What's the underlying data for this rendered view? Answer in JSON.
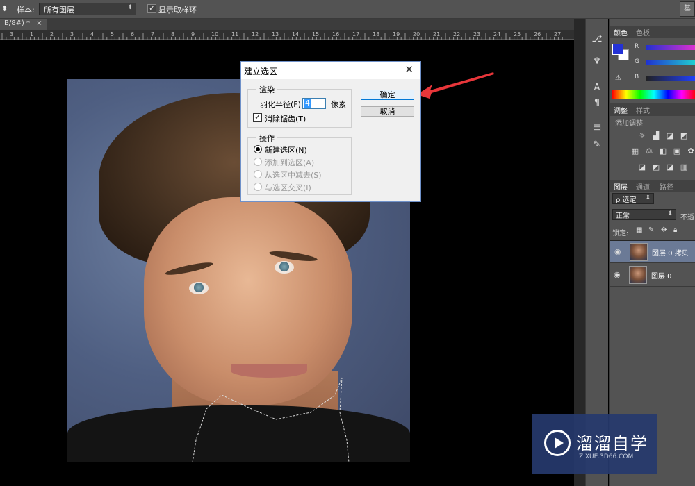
{
  "options_bar": {
    "sample_label": "样本:",
    "sample_value": "所有图层",
    "show_ring_label": "显示取样环",
    "show_ring_checked": true
  },
  "document": {
    "tab_title": "B/8#) *",
    "tab_close": "×",
    "ruler_ticks": [
      "3",
      "1",
      "2",
      "3",
      "4",
      "5",
      "6",
      "7",
      "8",
      "9",
      "10",
      "11",
      "12",
      "13",
      "14",
      "15",
      "16",
      "17",
      "18",
      "19",
      "20",
      "21",
      "22",
      "23",
      "24",
      "25",
      "26",
      "27"
    ]
  },
  "dialog": {
    "title": "建立选区",
    "close": "✕",
    "render_group": "渲染",
    "feather_label": "羽化半径(F):",
    "feather_value": "4",
    "feather_unit": "像素",
    "antialias_label": "消除锯齿(T)",
    "antialias_checked": true,
    "operation_group": "操作",
    "options": [
      {
        "label": "新建选区(N)",
        "selected": true,
        "enabled": true
      },
      {
        "label": "添加到选区(A)",
        "selected": false,
        "enabled": false
      },
      {
        "label": "从选区中减去(S)",
        "selected": false,
        "enabled": false
      },
      {
        "label": "与选区交叉(I)",
        "selected": false,
        "enabled": false
      }
    ],
    "ok": "确定",
    "cancel": "取消"
  },
  "panels": {
    "color_tabs": [
      "颜色",
      "色板"
    ],
    "channels": [
      "R",
      "G",
      "B"
    ],
    "adjust_tabs": [
      "调整",
      "样式"
    ],
    "add_adjustment": "添加调整",
    "layer_tabs": [
      "图层",
      "通道",
      "路径"
    ],
    "filter": "ρ 选定",
    "blend_mode": "正常",
    "opacity_label": "不透",
    "lock_label": "锁定:",
    "layers": [
      {
        "name": "图层 0 拷贝",
        "selected": true
      },
      {
        "name": "图层 0",
        "selected": false
      }
    ]
  },
  "colors": {
    "foreground": "#2432d6",
    "background": "#ffffff",
    "arrow": "#e8363a"
  },
  "watermark": {
    "title": "溜溜自学",
    "url": "ZIXUE.3D66.COM"
  }
}
